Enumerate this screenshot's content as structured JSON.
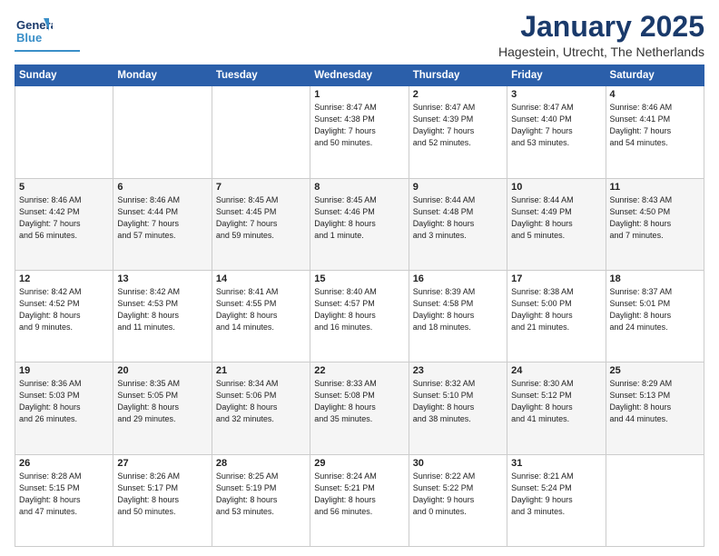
{
  "header": {
    "logo_general": "General",
    "logo_blue": "Blue",
    "month_title": "January 2025",
    "location": "Hagestein, Utrecht, The Netherlands"
  },
  "weekdays": [
    "Sunday",
    "Monday",
    "Tuesday",
    "Wednesday",
    "Thursday",
    "Friday",
    "Saturday"
  ],
  "weeks": [
    [
      {
        "day": "",
        "info": ""
      },
      {
        "day": "",
        "info": ""
      },
      {
        "day": "",
        "info": ""
      },
      {
        "day": "1",
        "info": "Sunrise: 8:47 AM\nSunset: 4:38 PM\nDaylight: 7 hours\nand 50 minutes."
      },
      {
        "day": "2",
        "info": "Sunrise: 8:47 AM\nSunset: 4:39 PM\nDaylight: 7 hours\nand 52 minutes."
      },
      {
        "day": "3",
        "info": "Sunrise: 8:47 AM\nSunset: 4:40 PM\nDaylight: 7 hours\nand 53 minutes."
      },
      {
        "day": "4",
        "info": "Sunrise: 8:46 AM\nSunset: 4:41 PM\nDaylight: 7 hours\nand 54 minutes."
      }
    ],
    [
      {
        "day": "5",
        "info": "Sunrise: 8:46 AM\nSunset: 4:42 PM\nDaylight: 7 hours\nand 56 minutes."
      },
      {
        "day": "6",
        "info": "Sunrise: 8:46 AM\nSunset: 4:44 PM\nDaylight: 7 hours\nand 57 minutes."
      },
      {
        "day": "7",
        "info": "Sunrise: 8:45 AM\nSunset: 4:45 PM\nDaylight: 7 hours\nand 59 minutes."
      },
      {
        "day": "8",
        "info": "Sunrise: 8:45 AM\nSunset: 4:46 PM\nDaylight: 8 hours\nand 1 minute."
      },
      {
        "day": "9",
        "info": "Sunrise: 8:44 AM\nSunset: 4:48 PM\nDaylight: 8 hours\nand 3 minutes."
      },
      {
        "day": "10",
        "info": "Sunrise: 8:44 AM\nSunset: 4:49 PM\nDaylight: 8 hours\nand 5 minutes."
      },
      {
        "day": "11",
        "info": "Sunrise: 8:43 AM\nSunset: 4:50 PM\nDaylight: 8 hours\nand 7 minutes."
      }
    ],
    [
      {
        "day": "12",
        "info": "Sunrise: 8:42 AM\nSunset: 4:52 PM\nDaylight: 8 hours\nand 9 minutes."
      },
      {
        "day": "13",
        "info": "Sunrise: 8:42 AM\nSunset: 4:53 PM\nDaylight: 8 hours\nand 11 minutes."
      },
      {
        "day": "14",
        "info": "Sunrise: 8:41 AM\nSunset: 4:55 PM\nDaylight: 8 hours\nand 14 minutes."
      },
      {
        "day": "15",
        "info": "Sunrise: 8:40 AM\nSunset: 4:57 PM\nDaylight: 8 hours\nand 16 minutes."
      },
      {
        "day": "16",
        "info": "Sunrise: 8:39 AM\nSunset: 4:58 PM\nDaylight: 8 hours\nand 18 minutes."
      },
      {
        "day": "17",
        "info": "Sunrise: 8:38 AM\nSunset: 5:00 PM\nDaylight: 8 hours\nand 21 minutes."
      },
      {
        "day": "18",
        "info": "Sunrise: 8:37 AM\nSunset: 5:01 PM\nDaylight: 8 hours\nand 24 minutes."
      }
    ],
    [
      {
        "day": "19",
        "info": "Sunrise: 8:36 AM\nSunset: 5:03 PM\nDaylight: 8 hours\nand 26 minutes."
      },
      {
        "day": "20",
        "info": "Sunrise: 8:35 AM\nSunset: 5:05 PM\nDaylight: 8 hours\nand 29 minutes."
      },
      {
        "day": "21",
        "info": "Sunrise: 8:34 AM\nSunset: 5:06 PM\nDaylight: 8 hours\nand 32 minutes."
      },
      {
        "day": "22",
        "info": "Sunrise: 8:33 AM\nSunset: 5:08 PM\nDaylight: 8 hours\nand 35 minutes."
      },
      {
        "day": "23",
        "info": "Sunrise: 8:32 AM\nSunset: 5:10 PM\nDaylight: 8 hours\nand 38 minutes."
      },
      {
        "day": "24",
        "info": "Sunrise: 8:30 AM\nSunset: 5:12 PM\nDaylight: 8 hours\nand 41 minutes."
      },
      {
        "day": "25",
        "info": "Sunrise: 8:29 AM\nSunset: 5:13 PM\nDaylight: 8 hours\nand 44 minutes."
      }
    ],
    [
      {
        "day": "26",
        "info": "Sunrise: 8:28 AM\nSunset: 5:15 PM\nDaylight: 8 hours\nand 47 minutes."
      },
      {
        "day": "27",
        "info": "Sunrise: 8:26 AM\nSunset: 5:17 PM\nDaylight: 8 hours\nand 50 minutes."
      },
      {
        "day": "28",
        "info": "Sunrise: 8:25 AM\nSunset: 5:19 PM\nDaylight: 8 hours\nand 53 minutes."
      },
      {
        "day": "29",
        "info": "Sunrise: 8:24 AM\nSunset: 5:21 PM\nDaylight: 8 hours\nand 56 minutes."
      },
      {
        "day": "30",
        "info": "Sunrise: 8:22 AM\nSunset: 5:22 PM\nDaylight: 9 hours\nand 0 minutes."
      },
      {
        "day": "31",
        "info": "Sunrise: 8:21 AM\nSunset: 5:24 PM\nDaylight: 9 hours\nand 3 minutes."
      },
      {
        "day": "",
        "info": ""
      }
    ]
  ]
}
